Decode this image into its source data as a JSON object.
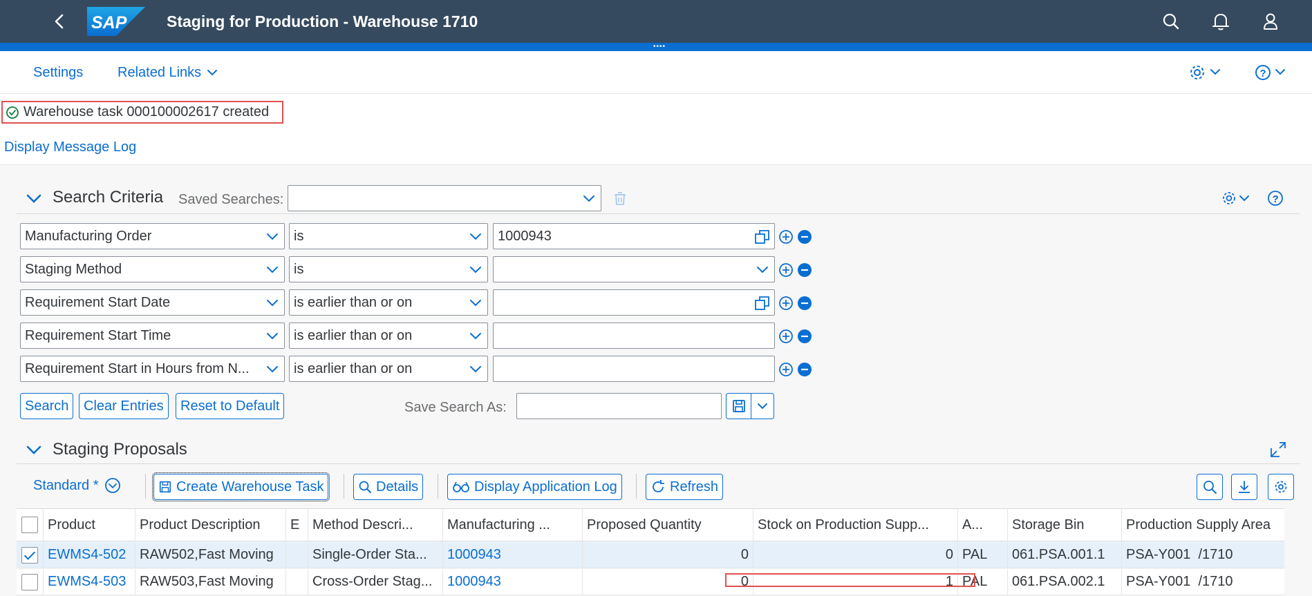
{
  "shell": {
    "title": "Staging for Production - Warehouse 1710",
    "logo_text": "SAP"
  },
  "subheader": {
    "settings": "Settings",
    "related_links": "Related Links"
  },
  "message": {
    "text": "Warehouse task 000100002617 created",
    "log_link": "Display Message Log"
  },
  "search_criteria": {
    "title": "Search Criteria",
    "saved_searches_label": "Saved Searches:",
    "saved_searches_value": "",
    "rows": [
      {
        "field": "Manufacturing Order",
        "operator": "is",
        "value": "1000943",
        "value_control": "value-help"
      },
      {
        "field": "Staging Method",
        "operator": "is",
        "value": "",
        "value_control": "dropdown"
      },
      {
        "field": "Requirement Start Date",
        "operator": "is earlier than or on",
        "value": "",
        "value_control": "value-help"
      },
      {
        "field": "Requirement Start Time",
        "operator": "is earlier than or on",
        "value": "",
        "value_control": "none"
      },
      {
        "field": "Requirement Start in Hours from N...",
        "operator": "is earlier than or on",
        "value": "",
        "value_control": "none"
      }
    ],
    "buttons": {
      "search": "Search",
      "clear": "Clear Entries",
      "reset": "Reset to Default"
    },
    "save_search_as_label": "Save Search As:",
    "save_search_as_value": ""
  },
  "staging_proposals": {
    "title": "Staging Proposals",
    "variant": "Standard *",
    "toolbar": {
      "create_task": "Create Warehouse Task",
      "details": "Details",
      "display_log": "Display Application Log",
      "refresh": "Refresh"
    },
    "columns": {
      "product": "Product",
      "product_description": "Product Description",
      "e": "E",
      "method_description": "Method Descri...",
      "manufacturing_order": "Manufacturing ...",
      "proposed_quantity": "Proposed Quantity",
      "stock_on_psa": "Stock on Production Supp...",
      "a": "A...",
      "storage_bin": "Storage Bin",
      "production_supply_area": "Production Supply Area"
    },
    "rows": [
      {
        "checked": true,
        "product": "EWMS4-502",
        "product_description": "RAW502,Fast Moving",
        "e": "",
        "method_description": "Single-Order Sta...",
        "manufacturing_order": "1000943",
        "proposed_quantity": "0",
        "stock_on_psa": "0",
        "a": "PAL",
        "storage_bin": "061.PSA.001.1",
        "production_supply_area": "PSA-Y001  /1710"
      },
      {
        "checked": false,
        "product": "EWMS4-503",
        "product_description": "RAW503,Fast Moving",
        "e": "",
        "method_description": "Cross-Order Stag...",
        "manufacturing_order": "1000943",
        "proposed_quantity": "0",
        "stock_on_psa": "1",
        "a": "PAL",
        "storage_bin": "061.PSA.002.1",
        "production_supply_area": "PSA-Y001  /1710"
      }
    ]
  },
  "colors": {
    "shell": "#354a5f",
    "brand_blue": "#0a6ed1",
    "highlight_red": "#e05050",
    "success_green": "#107e3e"
  }
}
